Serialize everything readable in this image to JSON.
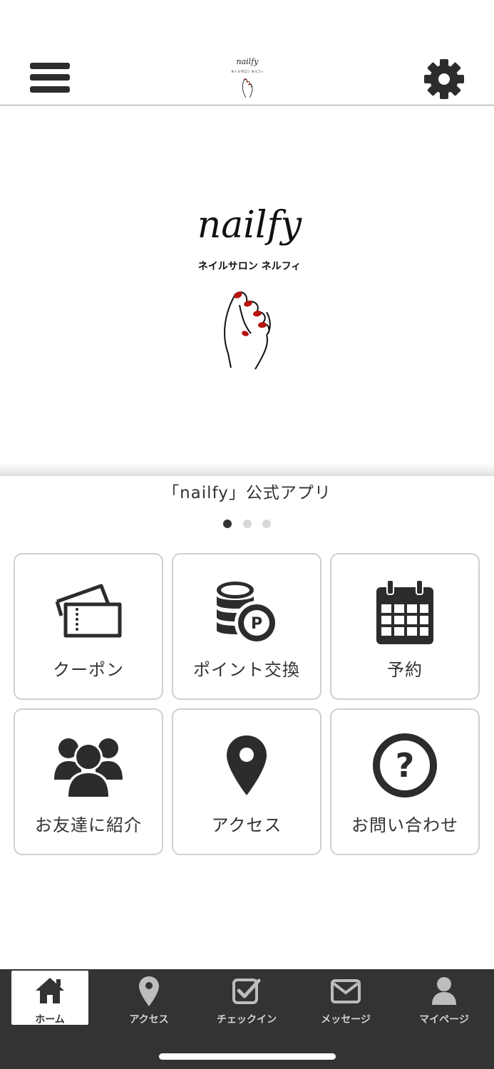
{
  "header": {
    "logo_text": "nailfy",
    "logo_subtext": "ネイルサロン ネルフィ"
  },
  "hero": {
    "logo_text": "nailfy",
    "logo_subtext": "ネイルサロン ネルフィ",
    "caption": "「nailfy」公式アプリ",
    "slides_total": 3,
    "slide_active": 1
  },
  "menu": {
    "coupon": "クーポン",
    "points": "ポイント交換",
    "reserve": "予約",
    "invite": "お友達に紹介",
    "access": "アクセス",
    "contact": "お問い合わせ"
  },
  "tabs": {
    "home": "ホーム",
    "access": "アクセス",
    "checkin": "チェックイン",
    "message": "メッセージ",
    "mypage": "マイページ"
  },
  "colors": {
    "icon": "#2c2c2c",
    "tabbar": "#333333",
    "nail_red": "#b5140f"
  }
}
